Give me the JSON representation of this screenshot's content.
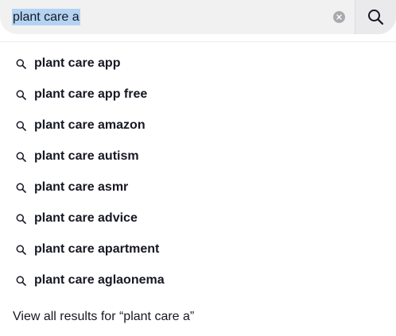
{
  "search": {
    "value": "plant care a"
  },
  "suggestions": [
    {
      "label": "plant care app"
    },
    {
      "label": "plant care app free"
    },
    {
      "label": "plant care amazon"
    },
    {
      "label": "plant care autism"
    },
    {
      "label": "plant care asmr"
    },
    {
      "label": "plant care advice"
    },
    {
      "label": "plant care apartment"
    },
    {
      "label": "plant care aglaonema"
    }
  ],
  "view_all": {
    "label": "View all results for “plant care a”"
  }
}
